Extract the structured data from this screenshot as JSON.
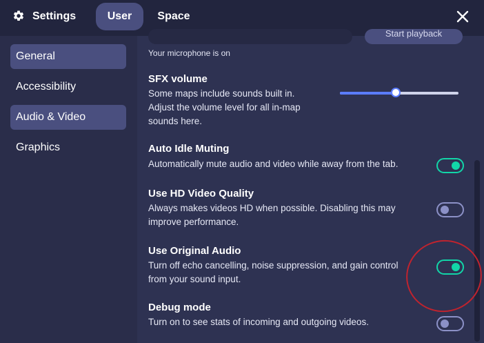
{
  "header": {
    "title": "Settings",
    "tabs": [
      {
        "label": "User",
        "active": true
      },
      {
        "label": "Space",
        "active": false
      }
    ]
  },
  "sidebar": {
    "items": [
      {
        "label": "General",
        "active": true
      },
      {
        "label": "Accessibility",
        "active": false
      },
      {
        "label": "Audio & Video",
        "active": true
      },
      {
        "label": "Graphics",
        "active": false
      }
    ]
  },
  "content": {
    "mic_button_label": "Start playback",
    "mic_status": "Your microphone is on",
    "sfx": {
      "title": "SFX volume",
      "desc_lines": [
        "Some maps include sounds built in.",
        "Adjust the volume level for all in-map",
        "sounds here."
      ],
      "volume_fraction": 0.47
    },
    "settings": [
      {
        "title": "Auto Idle Muting",
        "desc_lines": [
          "Automatically mute audio and video while away from the tab."
        ],
        "on": true
      },
      {
        "title": "Use HD Video Quality",
        "desc_lines": [
          "Always makes videos HD when possible. Disabling this may",
          "improve performance."
        ],
        "on": false
      },
      {
        "title": "Use Original Audio",
        "desc_lines": [
          "Turn off echo cancelling, noise suppression, and gain control",
          "from your sound input."
        ],
        "on": true
      },
      {
        "title": "Debug mode",
        "desc_lines": [
          "Turn on to see stats of incoming and outgoing videos."
        ],
        "on": false
      }
    ]
  },
  "colors": {
    "accent_on": "#12d6a8",
    "accent_off": "#8c91c7",
    "slider": "#5b7cff",
    "annotation": "#c0232e"
  }
}
